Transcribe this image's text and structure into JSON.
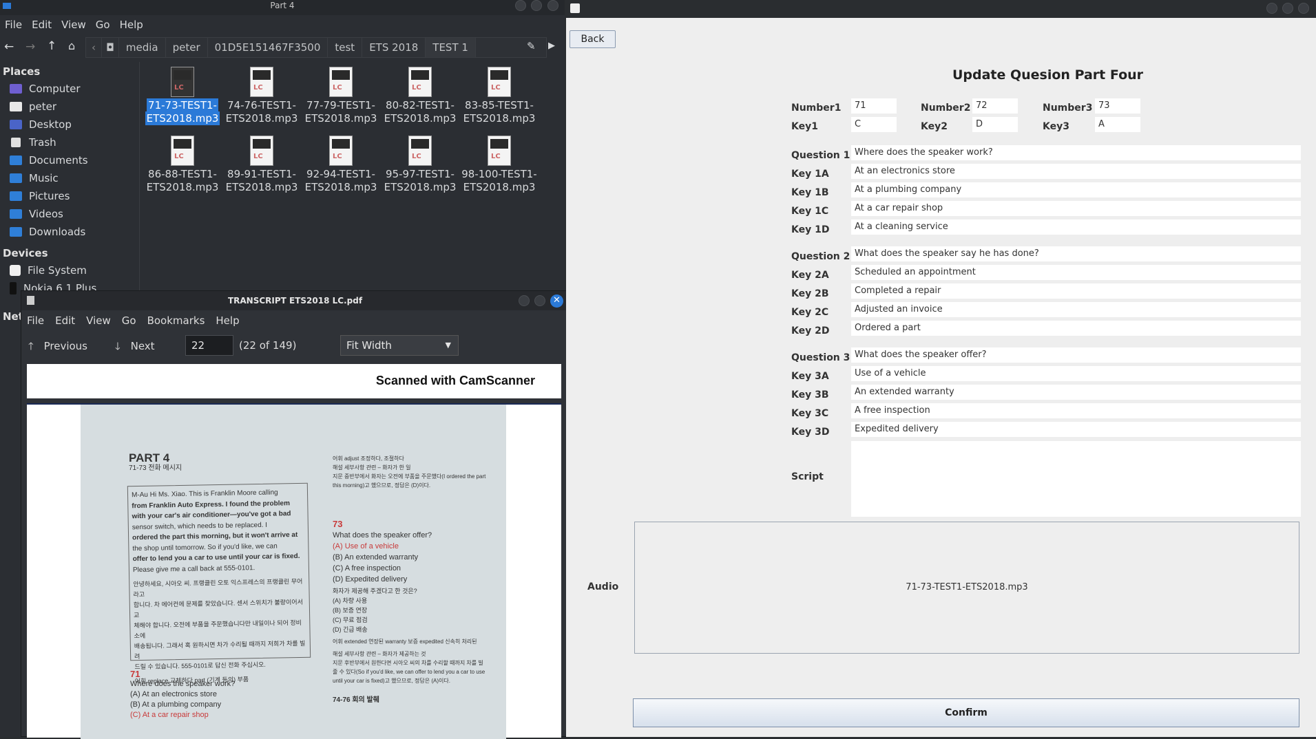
{
  "file_manager": {
    "title": "Part 4",
    "menu": [
      "File",
      "Edit",
      "View",
      "Go",
      "Help"
    ],
    "breadcrumbs": [
      "media",
      "peter",
      "01D5E151467F3500",
      "test",
      "ETS 2018",
      "TEST 1"
    ],
    "places_header": "Places",
    "places": [
      "Computer",
      "peter",
      "Desktop",
      "Trash",
      "Documents",
      "Music",
      "Pictures",
      "Videos",
      "Downloads"
    ],
    "devices_header": "Devices",
    "devices": [
      "File System",
      "Nokia 6.1 Plus"
    ],
    "network_header": "Net",
    "files": [
      "71-73-TEST1-ETS2018.mp3",
      "74-76-TEST1-ETS2018.mp3",
      "77-79-TEST1-ETS2018.mp3",
      "80-82-TEST1-ETS2018.mp3",
      "83-85-TEST1-ETS2018.mp3",
      "86-88-TEST1-ETS2018.mp3",
      "89-91-TEST1-ETS2018.mp3",
      "92-94-TEST1-ETS2018.mp3",
      "95-97-TEST1-ETS2018.mp3",
      "98-100-TEST1-ETS2018.mp3"
    ],
    "files_split": [
      [
        "71-73-TEST1-",
        "ETS2018.mp3"
      ],
      [
        "74-76-TEST1-",
        "ETS2018.mp3"
      ],
      [
        "77-79-TEST1-",
        "ETS2018.mp3"
      ],
      [
        "80-82-TEST1-",
        "ETS2018.mp3"
      ],
      [
        "83-85-TEST1-",
        "ETS2018.mp3"
      ],
      [
        "86-88-TEST1-",
        "ETS2018.mp3"
      ],
      [
        "89-91-TEST1-",
        "ETS2018.mp3"
      ],
      [
        "92-94-TEST1-",
        "ETS2018.mp3"
      ],
      [
        "95-97-TEST1-",
        "ETS2018.mp3"
      ],
      [
        "98-100-TEST1-",
        "ETS2018.mp3"
      ]
    ]
  },
  "pdf": {
    "title": "TRANSCRIPT ETS2018 LC.pdf",
    "menu": [
      "File",
      "Edit",
      "View",
      "Go",
      "Bookmarks",
      "Help"
    ],
    "previous": "Previous",
    "next": "Next",
    "page": "22",
    "page_count": "(22 of 149)",
    "zoom": "Fit Width",
    "scanner_banner": "Scanned with CamScanner",
    "page_left": {
      "heading": "PART 4",
      "sub": "71-73  전화 메시지",
      "box_lines": [
        "M-Au  Hi Ms. Xiao. This is Franklin Moore calling",
        "from Franklin Auto Express. I found the problem",
        "with your car's air conditioner—you've got a bad",
        "sensor switch, which needs to be replaced. I",
        "ordered the part this morning, but it won't arrive at",
        "the shop until tomorrow. So if you'd like, we can",
        "offer to lend you a car to use until your car is fixed.",
        "Please give me a call back at 555-0101."
      ],
      "korean_lines": [
        "안녕하세요, 시아오 씨. 프랭클린 오토 익스프레스의 프랭클린 무어라고",
        "합니다. 차 에어컨에 문제를 찾았습니다. 센서 스위치가 불량이어서 교",
        "체해야 합니다. 오전에 부품을 주문했습니다만 내일이나 되어 정비소에",
        "배송됩니다. 그래서 혹 원하시면 차가 수리될 때까지 저희가 차를 빌려",
        "드릴 수 있습니다. 555-0101로 답신 전화 주십시오."
      ],
      "vocab": "어휘  replace 교체하다   part (기계 등의) 부품",
      "q_no": "71",
      "q": "Where does the speaker work?",
      "opts": [
        "(A) At an electronics store",
        "(B) At a plumbing company",
        "(C) At a car repair shop"
      ]
    },
    "page_right": {
      "top_lines": [
        "어휘  adjust 조정하다, 조절하다",
        "해설  세부사항 관련 – 화자가 한 일",
        "지문 중반부에서 화자는 오전에 부품을 주문했다(I ordered the part",
        "this morning)고 했으므로, 정답은 (D)이다."
      ],
      "q_no": "73",
      "q": "What does the speaker offer?",
      "opts": [
        "(A) Use of a vehicle",
        "(B) An extended warranty",
        "(C) A free inspection",
        "(D) Expedited delivery"
      ],
      "korean_q": "화자가 제공해 주겠다고 한 것은?",
      "korean_opts": [
        "(A) 차량 사용",
        "(B) 보증 연장",
        "(C) 무료 점검",
        "(D) 긴급 배송"
      ],
      "vocab": "어휘  extended 연장된   warranty 보증   expedited 신속히 처리된",
      "expl": [
        "해설  세부사항 관련 – 화자가 제공하는 것",
        "지문 후반부에서 원한다면 시아오 씨의 차를 수리할 때까지 차를 빌",
        "줄 수 있다(So if you'd like, we can offer to lend you a car to use",
        "until your car is fixed)고 했으므로, 정답은 (A)이다."
      ],
      "footer": "74-76  회의 발췌"
    }
  },
  "form": {
    "back": "Back",
    "title": "Update Quesion Part Four",
    "number1_label": "Number1",
    "number1": "71",
    "number2_label": "Number2",
    "number2": "72",
    "number3_label": "Number3",
    "number3": "73",
    "key1_label": "Key1",
    "key1": "C",
    "key2_label": "Key2",
    "key2": "D",
    "key3_label": "Key3",
    "key3": "A",
    "groups": [
      {
        "q_label": "Question 1",
        "question": "Where does the speaker work?",
        "keys": [
          {
            "label": "Key 1A",
            "value": "At an electronics store"
          },
          {
            "label": "Key 1B",
            "value": "At a plumbing company"
          },
          {
            "label": "Key 1C",
            "value": "At a car repair shop"
          },
          {
            "label": "Key 1D",
            "value": "At a cleaning service"
          }
        ]
      },
      {
        "q_label": "Question 2",
        "question": "What does the speaker say he has done?",
        "keys": [
          {
            "label": "Key 2A",
            "value": "Scheduled an appointment"
          },
          {
            "label": "Key 2B",
            "value": "Completed a repair"
          },
          {
            "label": "Key 2C",
            "value": "Adjusted an invoice"
          },
          {
            "label": "Key 2D",
            "value": "Ordered a part"
          }
        ]
      },
      {
        "q_label": "Question 3",
        "question": "What does the speaker offer?",
        "keys": [
          {
            "label": "Key 3A",
            "value": "Use of a vehicle"
          },
          {
            "label": "Key 3B",
            "value": "An extended warranty"
          },
          {
            "label": "Key 3C",
            "value": "A free inspection"
          },
          {
            "label": "Key 3D",
            "value": "Expedited delivery"
          }
        ]
      }
    ],
    "script_label": "Script",
    "script": "",
    "audio_label": "Audio",
    "audio_file": "71-73-TEST1-ETS2018.mp3",
    "confirm": "Confirm"
  },
  "colors": {
    "selection": "#2b7ad8",
    "close_button": "#2b7ad8"
  }
}
